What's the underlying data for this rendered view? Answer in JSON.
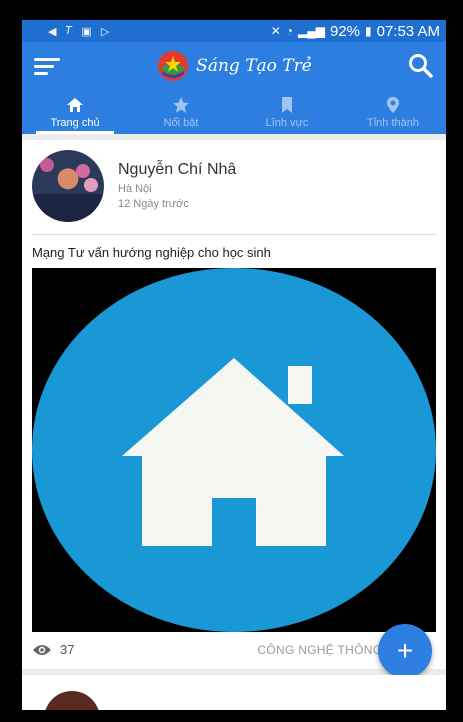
{
  "status_bar": {
    "battery": "92%",
    "time": "07:53 AM",
    "accent_color": "#1e6fd1"
  },
  "header": {
    "brand_title": "Sáng Tạo Trẻ",
    "menu_icon": "menu-icon",
    "search_icon": "search-icon",
    "color": "#2c7fe0"
  },
  "tabs": [
    {
      "label": "Trang chủ",
      "icon": "home-icon",
      "active": true
    },
    {
      "label": "Nổi bật",
      "icon": "star-icon",
      "active": false
    },
    {
      "label": "Lĩnh vực",
      "icon": "bookmark-icon",
      "active": false
    },
    {
      "label": "Tỉnh thành",
      "icon": "location-pin-icon",
      "active": false
    }
  ],
  "post": {
    "author_name": "Nguyễn Chí Nhâ",
    "location": "Hà Nội",
    "time_ago": "12 Ngày trước",
    "title": "Mạng Tư vấn hướng nghiệp cho học sinh",
    "image_icon": "house-icon",
    "image_bg": "#1a97d5",
    "views": "37",
    "category": "CÔNG NGHỆ THÔNG TIN"
  },
  "fab": {
    "label": "+"
  }
}
